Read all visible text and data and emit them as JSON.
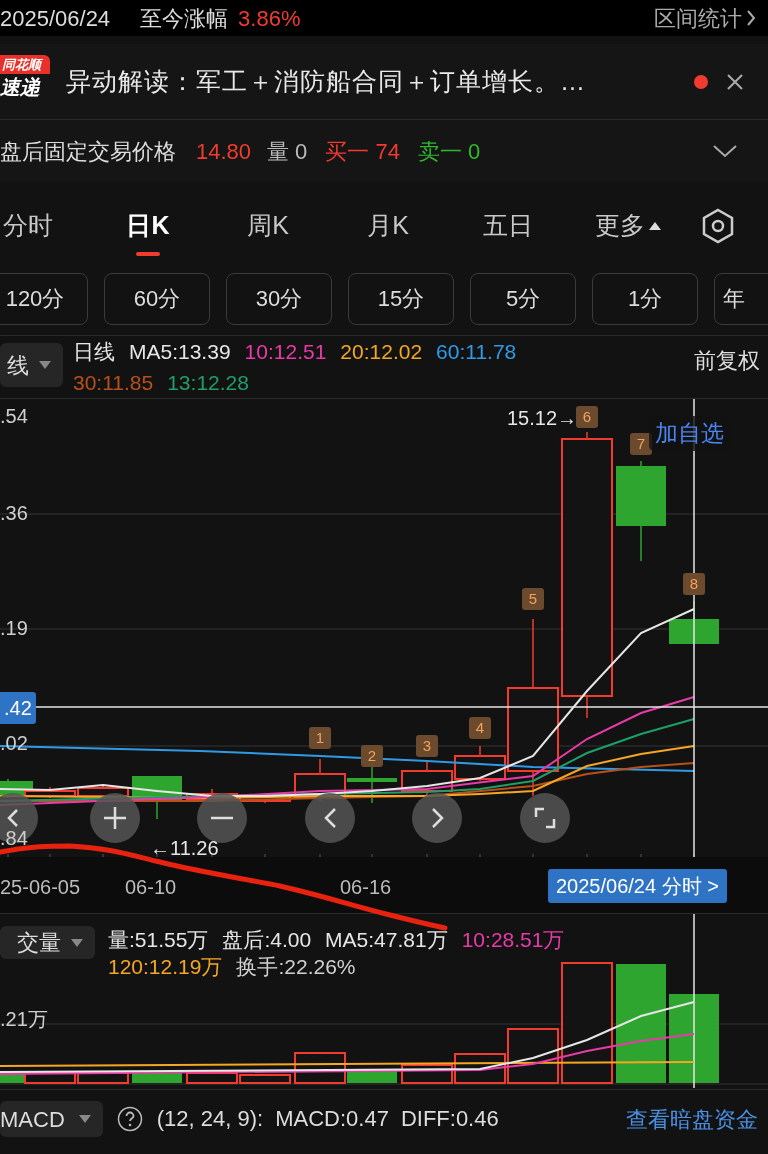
{
  "header": {
    "date": "2025/06/24",
    "change_label": "至今涨幅",
    "change_value": "3.86%",
    "range_stats": "区间统计"
  },
  "news": {
    "logo_top": "同花顺",
    "logo_bottom": "速递",
    "headline": "异动解读：军工＋消防船合同＋订单增长。…",
    "unread": true
  },
  "after_hours": {
    "label": "盘后固定交易价格",
    "price": "14.80",
    "volume_label": "量",
    "volume": "0",
    "bid": "买一 74",
    "ask": "卖一 0"
  },
  "tabs": [
    {
      "label": "分时",
      "selected": false
    },
    {
      "label": "日K",
      "selected": true
    },
    {
      "label": "周K",
      "selected": false
    },
    {
      "label": "月K",
      "selected": false
    },
    {
      "label": "五日",
      "selected": false
    },
    {
      "label": "更多",
      "selected": false
    }
  ],
  "periods": [
    {
      "label": "120分",
      "selected": false
    },
    {
      "label": "60分",
      "selected": false
    },
    {
      "label": "30分",
      "selected": false
    },
    {
      "label": "15分",
      "selected": false
    },
    {
      "label": "5分",
      "selected": false
    },
    {
      "label": "1分",
      "selected": false
    },
    {
      "label": "年",
      "selected": false
    }
  ],
  "indicator": {
    "dropdown": "线",
    "period": "日线",
    "ma_values": [
      {
        "text": "MA5:13.39",
        "color": "#e6e6e6"
      },
      {
        "text": "10:12.51",
        "color": "#e83aa8"
      },
      {
        "text": "20:12.02",
        "color": "#f5a623"
      },
      {
        "text": "60:11.78",
        "color": "#2f9be8"
      },
      {
        "text": "30:11.85",
        "color": "#b8501a"
      },
      {
        "text": "13:12.28",
        "color": "#1e9e6a"
      }
    ],
    "adjust": "前复权"
  },
  "chart": {
    "y_labels": [
      ".54",
      ".36",
      ".19",
      ".02",
      ".84"
    ],
    "crosshair_price": ".42",
    "high_marker": "15.12→",
    "low_marker": "←11.26",
    "event_markers": [
      "1",
      "2",
      "3",
      "4",
      "5",
      "6",
      "7",
      "8"
    ],
    "add_watchlist": "加自选",
    "x_labels": [
      "25-06-05",
      "06-10",
      "06-16"
    ],
    "crosshair_date": "2025/06/24 分时 >"
  },
  "volume": {
    "dropdown": "交量",
    "stats": [
      {
        "text": "量:51.55万",
        "color": "#e6e6e6"
      },
      {
        "text": "盘后:4.00",
        "color": "#e6e6e6"
      },
      {
        "text": "MA5:47.81万",
        "color": "#e6e6e6"
      },
      {
        "text": "10:28.51万",
        "color": "#e83aa8"
      },
      {
        "text": "120:12.19万",
        "color": "#f5a623"
      },
      {
        "text": "换手:22.26%",
        "color": "#d0d0d0"
      }
    ],
    "y_label": ".21万"
  },
  "macd": {
    "dropdown": "MACD",
    "params": "(12, 24, 9):",
    "values": [
      "MACD:0.47",
      "DIFF:0.46"
    ],
    "link": "查看暗盘资金"
  }
}
